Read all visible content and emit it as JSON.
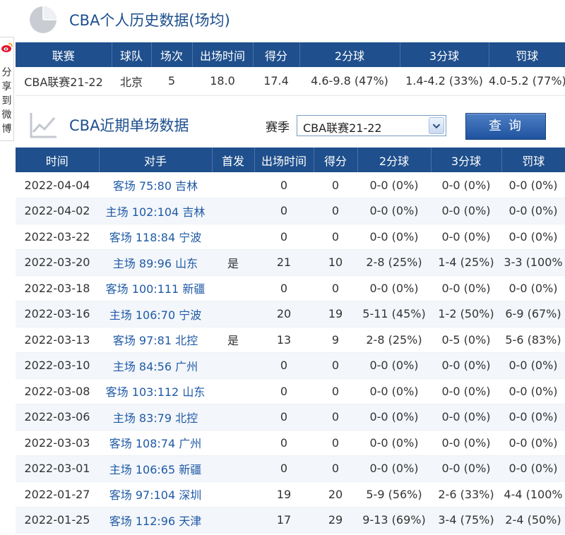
{
  "history": {
    "title": "CBA个人历史数据(场均)",
    "headers": [
      "联赛",
      "球队",
      "场次",
      "出场时间",
      "得分",
      "2分球",
      "3分球",
      "罚球"
    ],
    "row": [
      "CBA联赛21-22",
      "北京",
      "5",
      "18.0",
      "17.4",
      "4.6-9.8 (47%)",
      "1.4-4.2 (33%)",
      "4.0-5.2 (77%)"
    ]
  },
  "recent": {
    "title": "CBA近期单场数据",
    "season_label": "赛季",
    "season_value": "CBA联赛21-22",
    "query_label": "查询",
    "headers": [
      "时间",
      "对手",
      "首发",
      "出场时间",
      "得分",
      "2分球",
      "3分球",
      "罚球"
    ],
    "rows": [
      [
        "2022-04-04",
        "客场 75:80 吉林",
        "",
        "0",
        "0",
        "0-0 (0%)",
        "0-0 (0%)",
        "0-0 (0%)"
      ],
      [
        "2022-04-02",
        "主场 102:104 吉林",
        "",
        "0",
        "0",
        "0-0 (0%)",
        "0-0 (0%)",
        "0-0 (0%)"
      ],
      [
        "2022-03-22",
        "客场 118:84 宁波",
        "",
        "0",
        "0",
        "0-0 (0%)",
        "0-0 (0%)",
        "0-0 (0%)"
      ],
      [
        "2022-03-20",
        "主场 89:96 山东",
        "是",
        "21",
        "10",
        "2-8 (25%)",
        "1-4 (25%)",
        "3-3 (100%"
      ],
      [
        "2022-03-18",
        "客场 100:111 新疆",
        "",
        "0",
        "0",
        "0-0 (0%)",
        "0-0 (0%)",
        "0-0 (0%)"
      ],
      [
        "2022-03-16",
        "主场 106:70 宁波",
        "",
        "20",
        "19",
        "5-11 (45%)",
        "1-2 (50%)",
        "6-9 (67%)"
      ],
      [
        "2022-03-13",
        "客场 97:81 北控",
        "是",
        "13",
        "9",
        "2-8 (25%)",
        "0-5 (0%)",
        "5-6 (83%)"
      ],
      [
        "2022-03-10",
        "主场 84:56 广州",
        "",
        "0",
        "0",
        "0-0 (0%)",
        "0-0 (0%)",
        "0-0 (0%)"
      ],
      [
        "2022-03-08",
        "客场 103:112 山东",
        "",
        "0",
        "0",
        "0-0 (0%)",
        "0-0 (0%)",
        "0-0 (0%)"
      ],
      [
        "2022-03-06",
        "主场 83:79 北控",
        "",
        "0",
        "0",
        "0-0 (0%)",
        "0-0 (0%)",
        "0-0 (0%)"
      ],
      [
        "2022-03-03",
        "客场 108:74 广州",
        "",
        "0",
        "0",
        "0-0 (0%)",
        "0-0 (0%)",
        "0-0 (0%)"
      ],
      [
        "2022-03-01",
        "主场 106:65 新疆",
        "",
        "0",
        "0",
        "0-0 (0%)",
        "0-0 (0%)",
        "0-0 (0%)"
      ],
      [
        "2022-01-27",
        "客场 97:104 深圳",
        "",
        "19",
        "20",
        "5-9 (56%)",
        "2-6 (33%)",
        "4-4 (100%"
      ],
      [
        "2022-01-25",
        "客场 112:96 天津",
        "",
        "17",
        "29",
        "9-13 (69%)",
        "3-4 (75%)",
        "2-4 (50%)"
      ]
    ]
  },
  "share": {
    "chars": [
      "分",
      "享",
      "到",
      "微",
      "博"
    ]
  },
  "icons": {
    "pie": "pie-chart-icon",
    "line": "line-chart-icon",
    "weibo": "weibo-icon",
    "dropdown": "chevron-down-icon"
  },
  "colors": {
    "header_bg": "#1f4f8c",
    "title_text": "#1e4f8e",
    "link": "#1f5aa6"
  }
}
